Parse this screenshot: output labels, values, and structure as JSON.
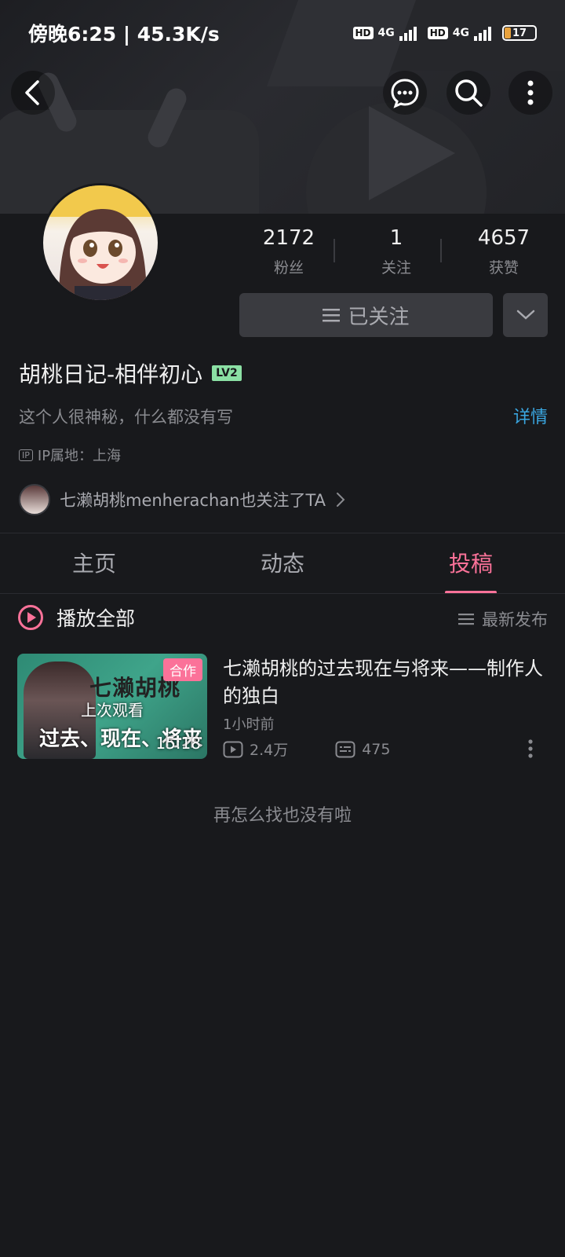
{
  "status_bar": {
    "time": "傍晚6:25 | 45.3K/s",
    "sim1_hd": "HD",
    "sim1_net": "4G",
    "sim2_hd": "HD",
    "sim2_net": "4G",
    "battery": "17"
  },
  "nav": {
    "back_icon": "chevron-left-icon",
    "message_icon": "chat-bubble-icon",
    "search_icon": "search-icon",
    "more_icon": "more-vertical-icon"
  },
  "profile": {
    "stats": [
      {
        "value": "2172",
        "label": "粉丝"
      },
      {
        "value": "1",
        "label": "关注"
      },
      {
        "value": "4657",
        "label": "获赞"
      }
    ],
    "follow_label": "已关注",
    "name": "胡桃日记-相伴初心",
    "level": "LV2",
    "bio": "这个人很神秘，什么都没有写",
    "detail_label": "详情",
    "ip_tag": "IP",
    "ip_location": "IP属地：上海",
    "mutual_text": "七濑胡桃menherachan也关注了TA"
  },
  "tabs": [
    {
      "label": "主页",
      "active": false
    },
    {
      "label": "动态",
      "active": false
    },
    {
      "label": "投稿",
      "active": true
    }
  ],
  "list_header": {
    "play_all": "播放全部",
    "sort": "最新发布"
  },
  "videos": [
    {
      "title": "七濑胡桃的过去现在与将来——制作人的独白",
      "badge": "合作",
      "overlay": "上次观看",
      "thumb_text_top": "七濑胡桃",
      "thumb_text_bottom": "过去、现在、将来",
      "duration": "15:18",
      "time": "1小时前",
      "plays": "2.4万",
      "comments": "475"
    }
  ],
  "end_text": "再怎么找也没有啦",
  "colors": {
    "accent": "#fb7299",
    "link": "#3aa6e0",
    "background": "#18191c"
  }
}
